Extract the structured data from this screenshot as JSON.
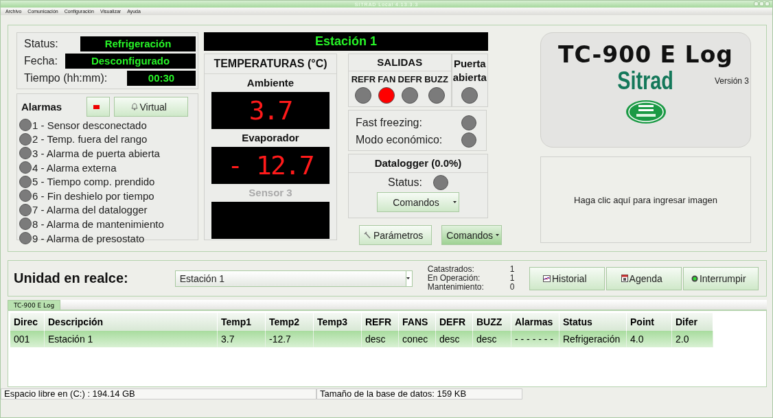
{
  "window": {
    "title": "SITRAD Local 4.13.3.3"
  },
  "menu": [
    "Archivo",
    "Comunicación",
    "Configuración",
    "Visualizar",
    "Ayuda"
  ],
  "info": [
    {
      "label": "Status:",
      "value": "Refrigeración"
    },
    {
      "label": "Fecha:",
      "value": "Desconfigurado"
    },
    {
      "label": "Tiempo (hh:mm):",
      "value": "00:30"
    }
  ],
  "station_name": "Estación 1",
  "alarms": {
    "title": "Alarmas",
    "virtual_button": "Virtual",
    "items": [
      {
        "label": "1 - Sensor desconectado",
        "active": false
      },
      {
        "label": "2 - Temp. fuera del rango",
        "active": false
      },
      {
        "label": "3 - Alarma de puerta abierta",
        "active": false
      },
      {
        "label": "4 - Alarma externa",
        "active": false
      },
      {
        "label": "5 - Tiempo comp. prendido",
        "active": false
      },
      {
        "label": "6 - Fin deshielo por tiempo",
        "active": false
      },
      {
        "label": "7 - Alarma del datalogger",
        "active": false
      },
      {
        "label": "8 - Alarma de mantenimiento",
        "active": false
      },
      {
        "label": "9 - Alarma de presostato",
        "active": false
      }
    ]
  },
  "temperatures": {
    "title": "TEMPERATURAS (°C)",
    "sensors": [
      {
        "label": "Ambiente",
        "value": "3.7",
        "disabled": false
      },
      {
        "label": "Evaporador",
        "value": "- 12.7",
        "disabled": false
      },
      {
        "label": "Sensor 3",
        "disabled": true
      }
    ]
  },
  "outputs": {
    "title": "SALIDAS",
    "items": [
      {
        "label": "REFR",
        "on": false
      },
      {
        "label": "FAN",
        "on": true
      },
      {
        "label": "DEFR",
        "on": false
      },
      {
        "label": "BUZZ",
        "on": false
      }
    ]
  },
  "door": {
    "label": "Puerta abierta",
    "on": false
  },
  "modes": [
    {
      "label": "Fast freezing:",
      "on": false
    },
    {
      "label": "Modo económico:",
      "on": false
    }
  ],
  "datalogger": {
    "title": "Datalogger (0.0%)",
    "status_label": "Status:",
    "status_on": false,
    "button": "Comandos"
  },
  "parameters_button": "Parámetros",
  "commands_button": "Comandos",
  "device": {
    "model": "TC-900 E Log",
    "brand": "Sitrad",
    "version": "Versión 3"
  },
  "image_hint": "Haga clic aquí para ingresar imagen",
  "highlight": {
    "label": "Unidad en realce:",
    "value": "Estación 1"
  },
  "counts": [
    {
      "label": "Catastrados:",
      "value": "1"
    },
    {
      "label": "En Operación:",
      "value": "1"
    },
    {
      "label": "Mantenimiento:",
      "value": "0"
    }
  ],
  "actions": [
    {
      "kind": "history",
      "label": "Historial"
    },
    {
      "kind": "agenda",
      "label": "Agenda"
    },
    {
      "kind": "stop",
      "label": "Interrumpir"
    }
  ],
  "tab": {
    "label": "TC-900 E Log",
    "selected": true
  },
  "table": {
    "columns": [
      "Direc",
      "Descripción",
      "Temp1",
      "Temp2",
      "Temp3",
      "REFR",
      "FANS",
      "DEFR",
      "BUZZ",
      "Alarmas",
      "Status",
      "Point",
      "Difer"
    ],
    "rows": [
      {
        "selected": true,
        "cells": [
          "001",
          "Estación 1",
          "3.7",
          "-12.7",
          "",
          "desc",
          "conec",
          "desc",
          "desc",
          "- - - - - - -",
          "Refrigeración",
          "4.0",
          "2.0"
        ]
      }
    ]
  },
  "status_bar": [
    "Espacio libre en (C:) : 194.14 GB",
    "Tamaño de la base de datos: 159 KB"
  ]
}
